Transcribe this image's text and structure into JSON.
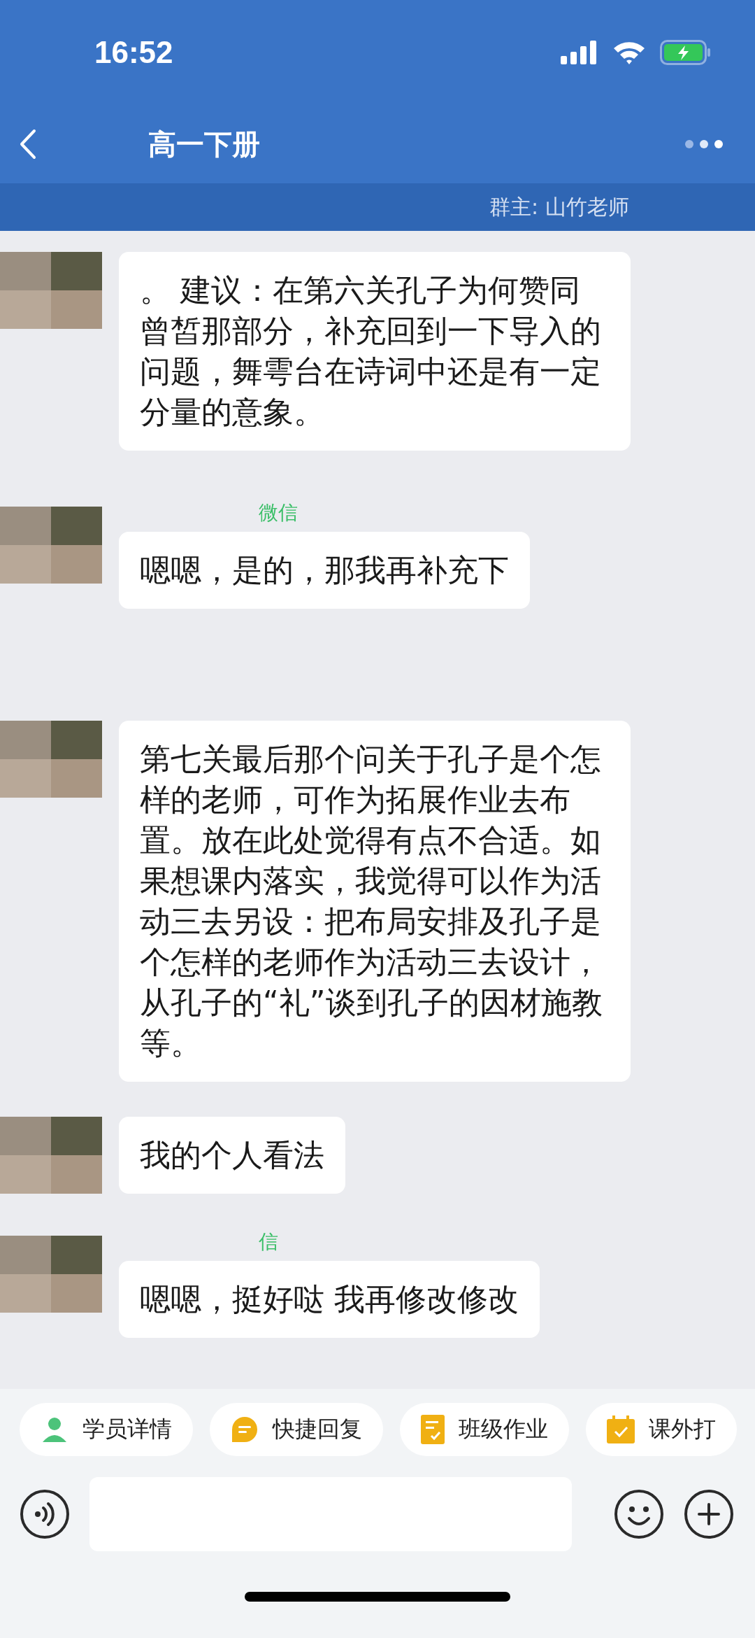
{
  "status_bar": {
    "time": "16:52"
  },
  "header": {
    "title": "高一下册",
    "subtitle": "群主: 山竹老师"
  },
  "messages": [
    {
      "text": "。 建议：在第六关孔子为何赞同曾皙那部分，补充回到一下导入的问题，舞雩台在诗词中还是有一定分量的意象。"
    },
    {
      "sender": "微信",
      "text": "嗯嗯，是的，那我再补充下"
    },
    {
      "text": "第七关最后那个问关于孔子是个怎样的老师，可作为拓展作业去布置。放在此处觉得有点不合适。如果想课内落实，我觉得可以作为活动三去另设：把布局安排及孔子是个怎样的老师作为活动三去设计，从孔子的“礼”谈到孔子的因材施教等。"
    },
    {
      "text": "我的个人看法"
    },
    {
      "sender": "信",
      "text": "嗯嗯，挺好哒  我再修改修改"
    }
  ],
  "shortcuts": [
    {
      "kind": "person",
      "label": "学员详情"
    },
    {
      "kind": "reply",
      "label": "快捷回复"
    },
    {
      "kind": "homework",
      "label": "班级作业"
    },
    {
      "kind": "checkin",
      "label": "课外打"
    }
  ]
}
